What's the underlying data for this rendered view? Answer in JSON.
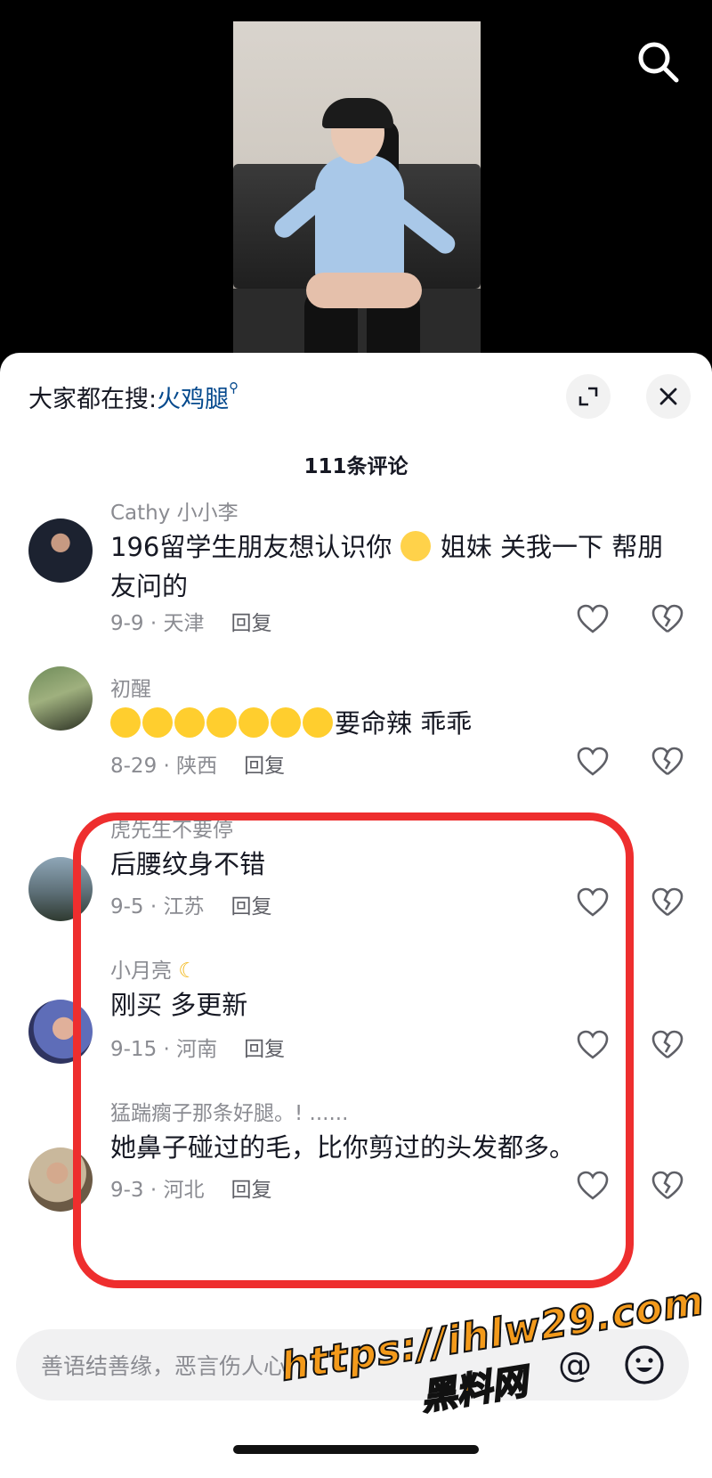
{
  "video": {
    "description_icon": "search-icon"
  },
  "sheet": {
    "hot_search_label": "大家都在搜:",
    "hot_search_keyword": "火鸡腿",
    "comment_count": "111条评论"
  },
  "comments": [
    {
      "username": "Cathy 小小李",
      "text_before": "196留学生朋友想认识你",
      "text_after": " 姐妹 关我一下 帮朋友问的",
      "date_loc": "9-9 · 天津",
      "reply": "回复"
    },
    {
      "username": "初醒",
      "text": "要命辣 乖乖",
      "date_loc": "8-29 · 陕西",
      "reply": "回复"
    },
    {
      "username": "虎先生不要停",
      "text": "后腰纹身不错",
      "date_loc": "9-5 · 江苏",
      "reply": "回复"
    },
    {
      "username": "小月亮",
      "text": "刚买 多更新",
      "date_loc": "9-15 · 河南",
      "reply": "回复"
    },
    {
      "username": "猛踹瘸子那条好腿。! ......",
      "text": "她鼻子碰过的毛，比你剪过的头发都多。",
      "date_loc": "9-3 · 河北",
      "reply": "回复"
    }
  ],
  "input": {
    "placeholder": "善语结善缘，恶言伤人心",
    "at_symbol": "@"
  },
  "watermark": {
    "url": "https://ihlw29.com",
    "name": "黑料网"
  },
  "colors": {
    "highlight_border": "#ee2e2e",
    "keyword": "#04498d",
    "watermark": "#f39a1b"
  }
}
